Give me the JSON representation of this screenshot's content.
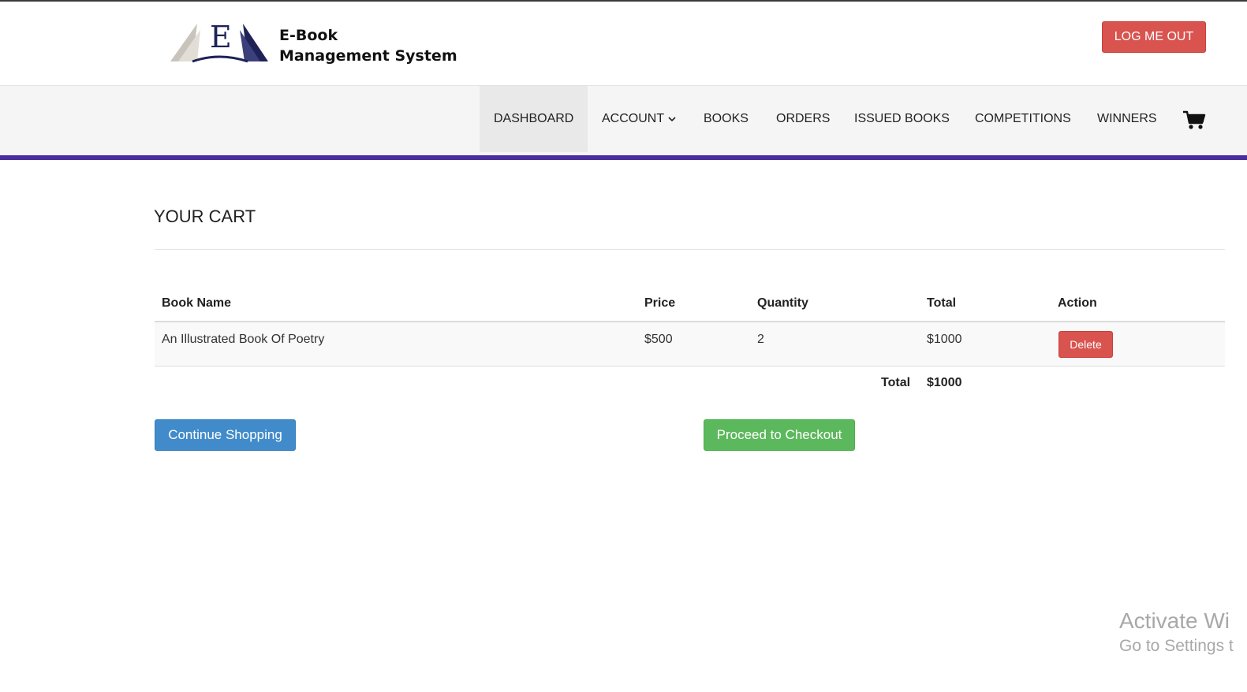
{
  "header": {
    "logo_line1": "E-Book",
    "logo_line2": "Management System",
    "logo_letter": "E",
    "logout_label": "LOG ME OUT"
  },
  "nav": {
    "items": [
      {
        "label": "DASHBOARD",
        "active": true
      },
      {
        "label": "ACCOUNT",
        "dropdown": true
      },
      {
        "label": "BOOKS"
      },
      {
        "label": "ORDERS"
      },
      {
        "label": "ISSUED BOOKS"
      },
      {
        "label": "COMPETITIONS"
      },
      {
        "label": "WINNERS"
      }
    ],
    "cart_icon": "cart-icon",
    "accent_color": "#4a2ea0"
  },
  "cart": {
    "title": "YOUR CART",
    "columns": [
      "Book Name",
      "Price",
      "Quantity",
      "Total",
      "Action"
    ],
    "rows": [
      {
        "book_name": "An Illustrated Book Of Poetry",
        "price": "$500",
        "quantity": "2",
        "total": "$1000",
        "action": "Delete"
      }
    ],
    "total_label": "Total",
    "total_value": "$1000",
    "continue_label": "Continue Shopping",
    "checkout_label": "Proceed to Checkout"
  },
  "watermark": {
    "line1": "Activate Wi",
    "line2": "Go to Settings t"
  },
  "colors": {
    "danger": "#d9534f",
    "primary": "#428bca",
    "success": "#5cb85c"
  }
}
